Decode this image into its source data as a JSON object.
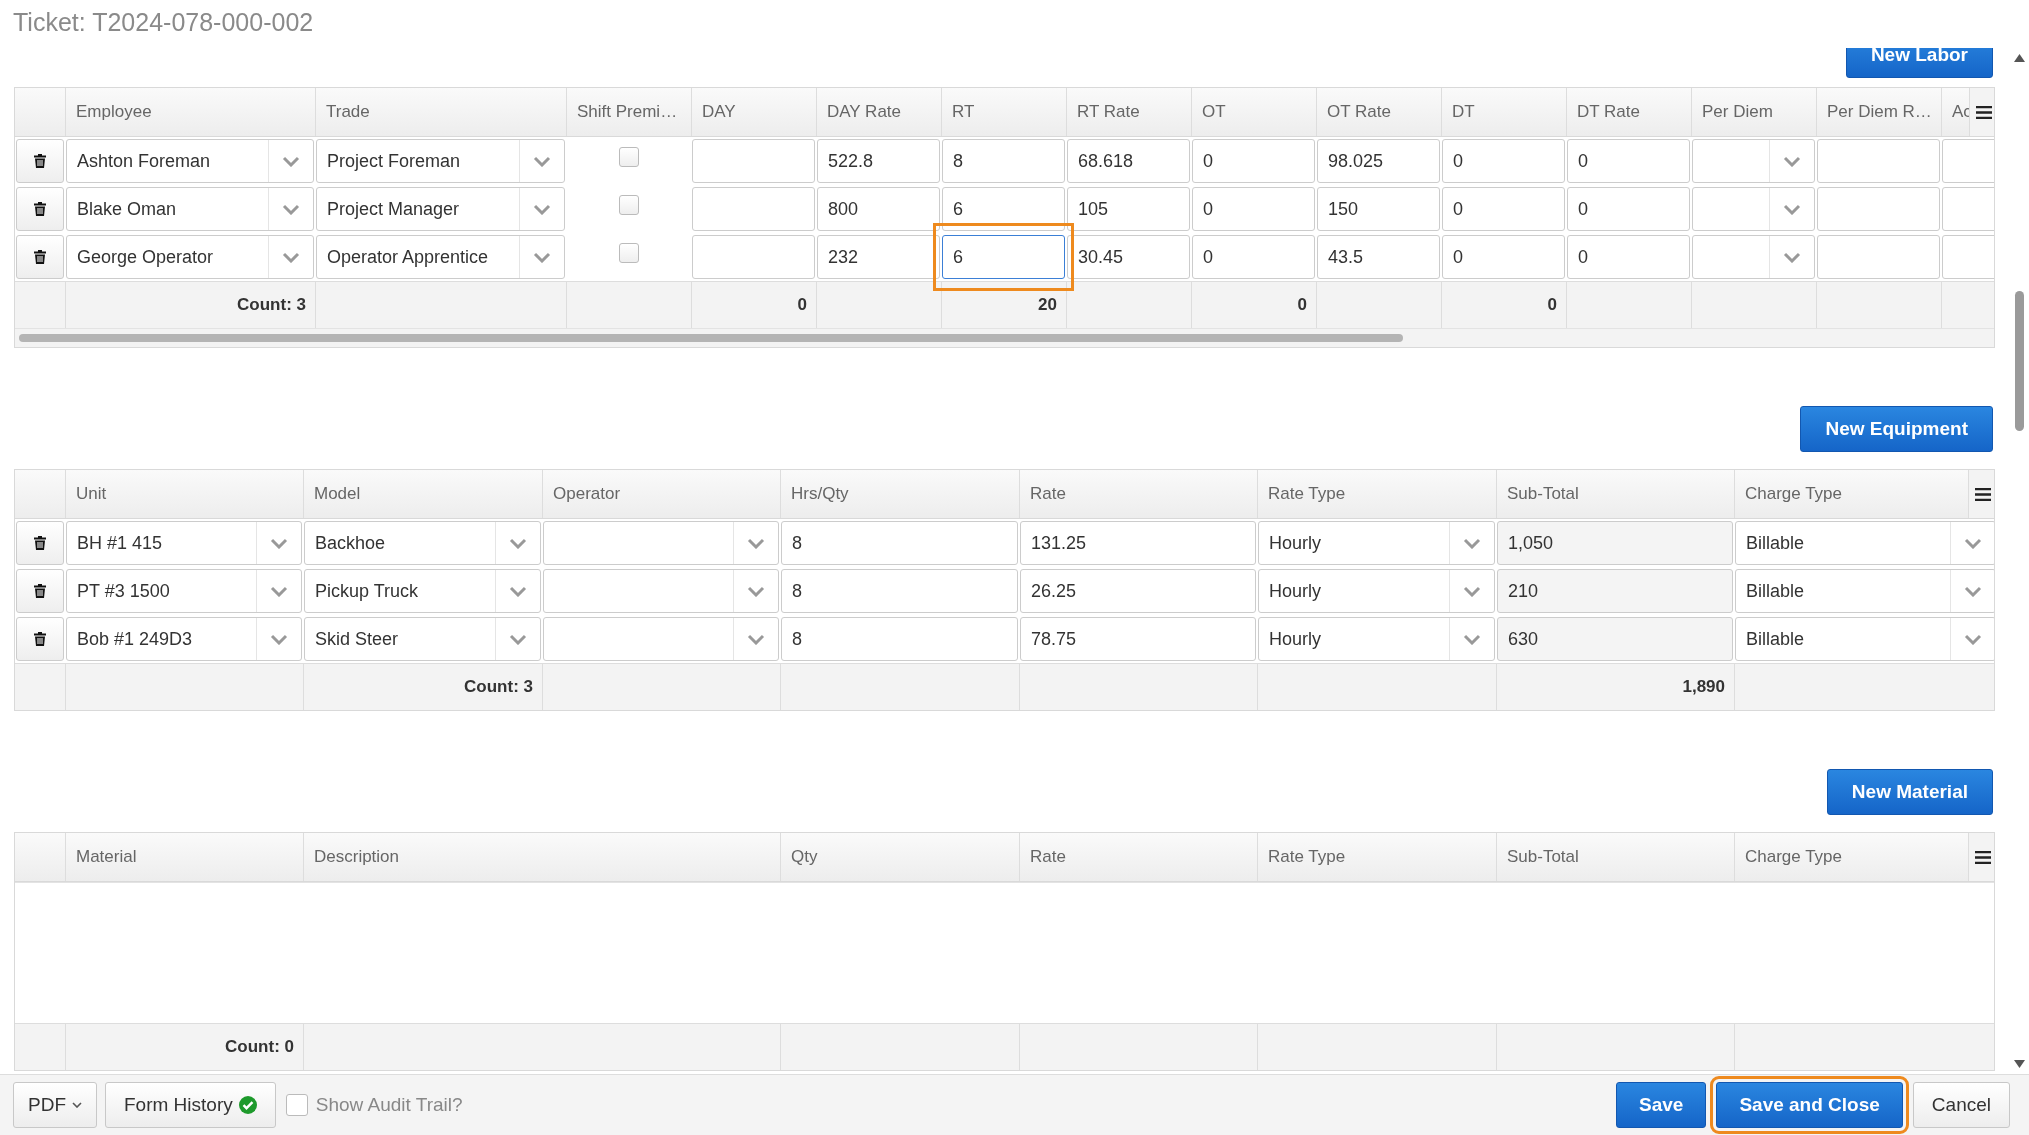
{
  "ticket_title": "Ticket: T2024-078-000-002",
  "sections": [
    {
      "kind": "labor",
      "button": "New Labor",
      "button_clipped": true,
      "scroll_bar": true,
      "columns": [
        "Employee",
        "Trade",
        "Shift Premi…",
        "DAY",
        "DAY Rate",
        "RT",
        "RT Rate",
        "OT",
        "OT Rate",
        "DT",
        "DT Rate",
        "Per Diem",
        "Per Diem R…",
        "Ac"
      ],
      "rows": [
        {
          "cells": [
            {
              "kind": "select",
              "value": "Ashton Foreman"
            },
            {
              "kind": "select",
              "value": "Project Foreman"
            },
            {
              "kind": "checkbox",
              "checked": false
            },
            {
              "kind": "input"
            },
            {
              "kind": "input",
              "value": "522.8"
            },
            {
              "kind": "input",
              "value": "8"
            },
            {
              "kind": "input",
              "value": "68.618"
            },
            {
              "kind": "input",
              "value": "0"
            },
            {
              "kind": "input",
              "value": "98.025"
            },
            {
              "kind": "input",
              "value": "0"
            },
            {
              "kind": "input",
              "value": "0"
            },
            {
              "kind": "select"
            },
            {
              "kind": "input"
            },
            {
              "kind": "input"
            }
          ]
        },
        {
          "cells": [
            {
              "kind": "select",
              "value": "Blake Oman"
            },
            {
              "kind": "select",
              "value": "Project Manager"
            },
            {
              "kind": "checkbox",
              "checked": false
            },
            {
              "kind": "input"
            },
            {
              "kind": "input",
              "value": "800"
            },
            {
              "kind": "input",
              "value": "6"
            },
            {
              "kind": "input",
              "value": "105"
            },
            {
              "kind": "input",
              "value": "0"
            },
            {
              "kind": "input",
              "value": "150"
            },
            {
              "kind": "input",
              "value": "0"
            },
            {
              "kind": "input",
              "value": "0"
            },
            {
              "kind": "select"
            },
            {
              "kind": "input"
            },
            {
              "kind": "input"
            }
          ]
        },
        {
          "cells": [
            {
              "kind": "select",
              "value": "George Operator"
            },
            {
              "kind": "select",
              "value": "Operator Apprentice"
            },
            {
              "kind": "checkbox",
              "checked": false
            },
            {
              "kind": "input"
            },
            {
              "kind": "input",
              "value": "232"
            },
            {
              "kind": "input",
              "value": "6",
              "focused": true,
              "highlighted": true
            },
            {
              "kind": "input",
              "value": "30.45"
            },
            {
              "kind": "input",
              "value": "0"
            },
            {
              "kind": "input",
              "value": "43.5"
            },
            {
              "kind": "input",
              "value": "0"
            },
            {
              "kind": "input",
              "value": "0"
            },
            {
              "kind": "select"
            },
            {
              "kind": "input"
            },
            {
              "kind": "input"
            }
          ]
        }
      ],
      "footer": [
        {
          "kind": "total",
          "text": "Count: 3"
        },
        {
          "kind": "blank"
        },
        {
          "kind": "blank"
        },
        {
          "kind": "total",
          "text": "0"
        },
        {
          "kind": "blank"
        },
        {
          "kind": "total",
          "text": "20"
        },
        {
          "kind": "blank"
        },
        {
          "kind": "total",
          "text": "0"
        },
        {
          "kind": "blank"
        },
        {
          "kind": "total",
          "text": "0"
        },
        {
          "kind": "blank"
        },
        {
          "kind": "blank"
        },
        {
          "kind": "blank"
        },
        {
          "kind": "blank"
        }
      ]
    },
    {
      "kind": "equipment",
      "button": "New Equipment",
      "button_clipped": false,
      "scroll_bar": false,
      "columns": [
        "Unit",
        "Model",
        "Operator",
        "Hrs/Qty",
        "Rate",
        "Rate Type",
        "Sub-Total",
        "Charge Type"
      ],
      "rows": [
        {
          "cells": [
            {
              "kind": "select",
              "value": "BH #1 415"
            },
            {
              "kind": "select",
              "value": "Backhoe"
            },
            {
              "kind": "select"
            },
            {
              "kind": "input",
              "value": "8"
            },
            {
              "kind": "input",
              "value": "131.25"
            },
            {
              "kind": "select",
              "value": "Hourly"
            },
            {
              "kind": "readonly",
              "value": "1,050"
            },
            {
              "kind": "select",
              "value": "Billable"
            }
          ]
        },
        {
          "cells": [
            {
              "kind": "select",
              "value": "PT #3 1500"
            },
            {
              "kind": "select",
              "value": "Pickup Truck"
            },
            {
              "kind": "select"
            },
            {
              "kind": "input",
              "value": "8"
            },
            {
              "kind": "input",
              "value": "26.25"
            },
            {
              "kind": "select",
              "value": "Hourly"
            },
            {
              "kind": "readonly",
              "value": "210"
            },
            {
              "kind": "select",
              "value": "Billable"
            }
          ]
        },
        {
          "cells": [
            {
              "kind": "select",
              "value": "Bob #1 249D3"
            },
            {
              "kind": "select",
              "value": "Skid Steer"
            },
            {
              "kind": "select"
            },
            {
              "kind": "input",
              "value": "8"
            },
            {
              "kind": "input",
              "value": "78.75"
            },
            {
              "kind": "select",
              "value": "Hourly"
            },
            {
              "kind": "readonly",
              "value": "630"
            },
            {
              "kind": "select",
              "value": "Billable"
            }
          ]
        }
      ],
      "footer": [
        {
          "kind": "blank"
        },
        {
          "kind": "total",
          "text": "Count: 3"
        },
        {
          "kind": "blank"
        },
        {
          "kind": "blank"
        },
        {
          "kind": "blank"
        },
        {
          "kind": "blank"
        },
        {
          "kind": "total",
          "text": "1,890"
        },
        {
          "kind": "blank"
        }
      ]
    },
    {
      "kind": "material",
      "button": "New Material",
      "button_clipped": false,
      "scroll_bar": false,
      "columns": [
        "Material",
        "Description",
        "Qty",
        "Rate",
        "Rate Type",
        "Sub-Total",
        "Charge Type"
      ],
      "footer": [
        {
          "kind": "total",
          "text": "Count: 0"
        },
        {
          "kind": "blank"
        },
        {
          "kind": "blank"
        },
        {
          "kind": "blank"
        },
        {
          "kind": "blank"
        },
        {
          "kind": "blank"
        },
        {
          "kind": "blank"
        }
      ]
    }
  ],
  "bottom_bar": {
    "pdf_button": "PDF",
    "form_history_button": "Form History",
    "form_history_complete": true,
    "audit_trail": {
      "label": "Show Audit Trail?",
      "checked": false
    },
    "buttons": [
      {
        "kind": "primary",
        "label": "Save",
        "highlighted": false
      },
      {
        "kind": "primary",
        "label": "Save and Close",
        "highlighted": true
      },
      {
        "kind": "default",
        "label": "Cancel",
        "highlighted": false
      }
    ]
  }
}
